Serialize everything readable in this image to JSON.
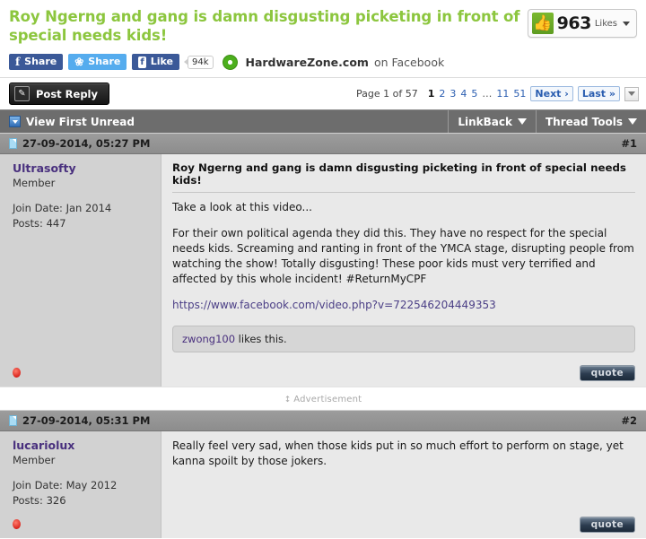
{
  "thread": {
    "title": "Roy Ngerng and gang is damn disgusting picketing in front of special needs kids!"
  },
  "likes_widget": {
    "icon": "thumbs-up-icon",
    "glyph": "👍",
    "count": "963",
    "label": "Likes",
    "accent_color": "#6fae2a"
  },
  "social": {
    "facebook_share": "Share",
    "twitter_share": "Share",
    "facebook_like": "Like",
    "like_count": "94k",
    "brand": "HardwareZone.com",
    "brand_suffix": "on Facebook",
    "fb_glyph": "f",
    "tw_glyph": "✓",
    "fb_like_glyph": "f"
  },
  "toolbar": {
    "post_reply": "Post Reply",
    "pencil_glyph": "✎"
  },
  "pagination": {
    "status": "Page 1 of 57",
    "pages": [
      "1",
      "2",
      "3",
      "4",
      "5"
    ],
    "ellipsis": "…",
    "tail_pages": [
      "11",
      "51"
    ],
    "next": "Next ›",
    "last": "Last »"
  },
  "thread_bar": {
    "view_first_unread": "View First Unread",
    "linkback": "LinkBack",
    "thread_tools": "Thread Tools"
  },
  "posts": [
    {
      "date": "27-09-2014, 05:27 PM",
      "number": "#1",
      "user": {
        "name": "Ultrasofty",
        "title": "Member",
        "join_date": "Join Date: Jan 2014",
        "posts": "Posts: 447"
      },
      "title": "Roy Ngerng and gang is damn disgusting picketing in front of special needs kids!",
      "paragraphs": [
        "Take a look at this video...",
        "For their own political agenda they did this. They have no respect for the special needs kids. Screaming and ranting in front of the YMCA stage, disrupting people from watching the show! Totally disgusting! These poor kids must very terrified and affected by this whole incident! #ReturnMyCPF"
      ],
      "link": "https://www.facebook.com/video.php?v=722546204449353",
      "likes_text_user": "zwong100",
      "likes_text_rest": " likes this.",
      "quote": "quote"
    },
    {
      "date": "27-09-2014, 05:31 PM",
      "number": "#2",
      "user": {
        "name": "lucariolux",
        "title": "Member",
        "join_date": "Join Date: May 2012",
        "posts": "Posts: 326"
      },
      "paragraphs": [
        "Really feel very sad, when those kids put in so much effort to perform on stage, yet kanna spoilt by those jokers."
      ],
      "quote": "quote"
    }
  ],
  "advertisement": {
    "label": "Advertisement",
    "arrows_glyph": "↕"
  }
}
